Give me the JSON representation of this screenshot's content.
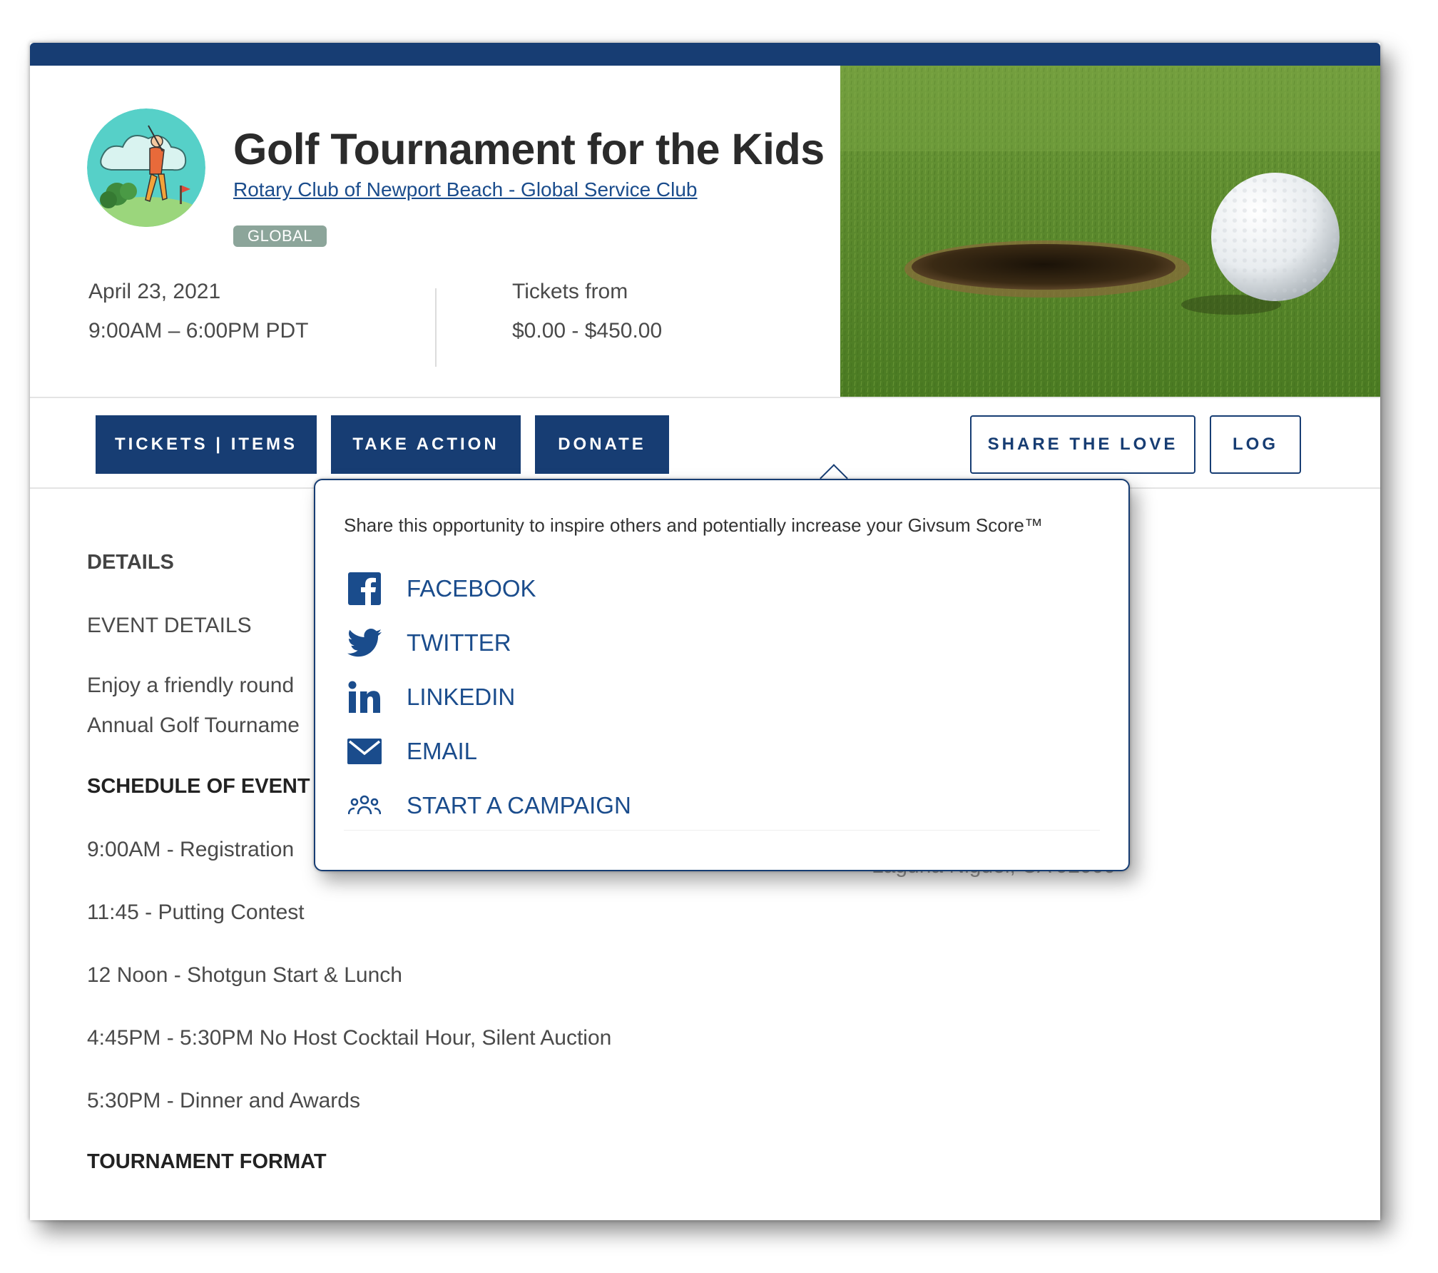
{
  "event": {
    "title": "Golf Tournament for the Kids",
    "organizer": "Rotary Club of Newport Beach - Global Service Club",
    "badge": "GLOBAL",
    "date": "April 23, 2021",
    "time": "9:00AM – 6:00PM PDT",
    "tickets_label": "Tickets from",
    "tickets_range": "$0.00 - $450.00"
  },
  "actions": {
    "tickets": "TICKETS | ITEMS",
    "take_action": "TAKE ACTION",
    "donate": "DONATE",
    "share": "SHARE THE LOVE",
    "log": "LOG"
  },
  "details": {
    "heading": "DETAILS",
    "event_details": "EVENT DETAILS",
    "desc_line1": "Enjoy a friendly round",
    "desc_line2": "Annual Golf Tourname",
    "schedule_heading": "SCHEDULE OF EVENT",
    "schedule": [
      "9:00AM - Registration",
      "11:45 - Putting Contest",
      "12 Noon - Shotgun Start & Lunch",
      "4:45PM - 5:30PM No Host Cocktail Hour, Silent Auction",
      "5:30PM - Dinner and Awards"
    ],
    "format_heading": "TOURNAMENT FORMAT",
    "location_partial": "Laguna Niguel, CA 92000"
  },
  "share_popover": {
    "intro": "Share this opportunity to inspire others and potentially increase your Givsum Score™",
    "options": [
      {
        "label": "FACEBOOK",
        "icon": "facebook-icon"
      },
      {
        "label": "TWITTER",
        "icon": "twitter-icon"
      },
      {
        "label": "LINKEDIN",
        "icon": "linkedin-icon"
      },
      {
        "label": "EMAIL",
        "icon": "email-icon"
      },
      {
        "label": "START A CAMPAIGN",
        "icon": "people-icon"
      }
    ]
  },
  "colors": {
    "brand_navy": "#173d73",
    "link_blue": "#1a4c8c",
    "badge_green": "#8ca59a"
  }
}
